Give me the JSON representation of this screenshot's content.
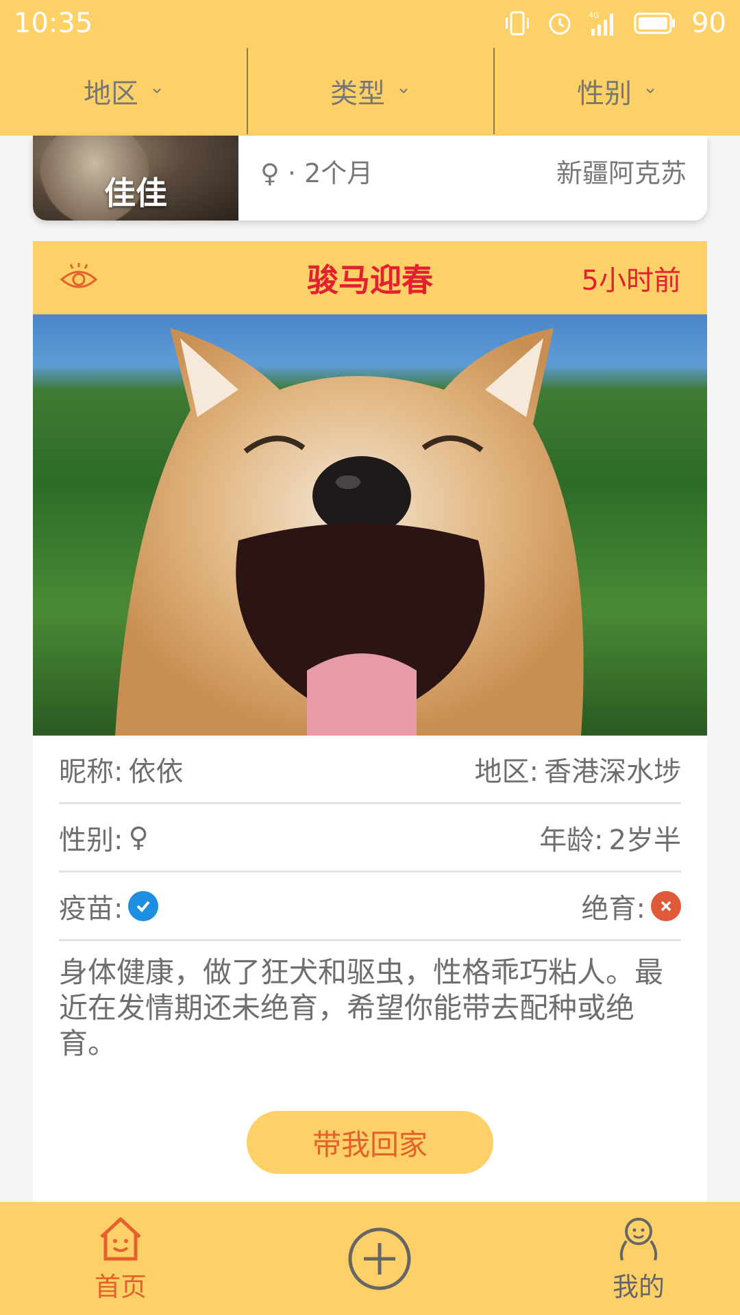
{
  "status_bar": {
    "time": "10:35",
    "network": "4G",
    "battery": "90"
  },
  "filters": [
    {
      "label": "地区"
    },
    {
      "label": "类型"
    },
    {
      "label": "性别"
    }
  ],
  "prev_card": {
    "name": "佳佳",
    "gender_age": "♀ · 2个月",
    "location": "新疆阿克苏"
  },
  "card": {
    "title": "骏马迎春",
    "time": "5小时前",
    "nickname_label": "昵称:",
    "nickname": "依依",
    "region_label": "地区:",
    "region": "香港深水埗",
    "gender_label": "性别:",
    "gender": "♀",
    "age_label": "年龄:",
    "age": "2岁半",
    "vaccine_label": "疫苗:",
    "vaccine_done": true,
    "neuter_label": "绝育:",
    "neuter_done": false,
    "description": "身体健康，做了狂犬和驱虫，性格乖巧粘人。最近在发情期还未绝育，希望你能带去配种或绝育。",
    "adopt_button": "带我回家"
  },
  "bottom_nav": {
    "home": "首页",
    "me": "我的"
  },
  "colors": {
    "accent": "#fdd068",
    "title_red": "#e2202f",
    "orange": "#e5602a",
    "check_blue": "#1e8fe0",
    "cross_red": "#e05a3a"
  }
}
